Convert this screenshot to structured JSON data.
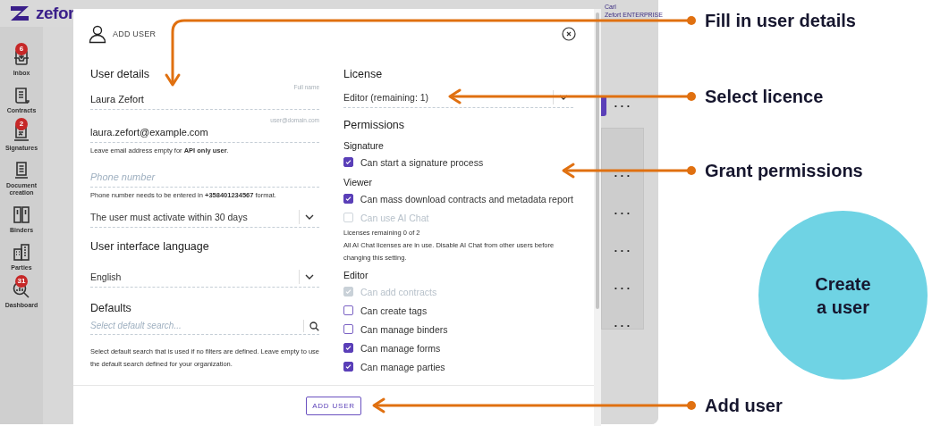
{
  "app": {
    "logo_text": "zefor",
    "user_name": "Carl",
    "user_org": "Zefort ENTERPRISE"
  },
  "sidebar": {
    "items": [
      {
        "label": "Inbox",
        "badge": "6"
      },
      {
        "label": "Contracts"
      },
      {
        "label": "Signatures",
        "badge": "2"
      },
      {
        "label": "Document creation"
      },
      {
        "label": "Binders"
      },
      {
        "label": "Parties"
      },
      {
        "label": "Dashboard",
        "badge": "31"
      }
    ]
  },
  "background_table": {
    "row_menus": [
      "• • •",
      "• • •",
      "• • •",
      "• • •",
      "• • •",
      "• • •"
    ]
  },
  "modal": {
    "title": "ADD USER",
    "user_details": {
      "heading": "User details",
      "full_name": {
        "label": "Full name",
        "value": "Laura Zefort"
      },
      "email": {
        "label": "user@domain.com",
        "value": "laura.zefort@example.com",
        "hint": "Leave email address empty for **API only user**."
      },
      "phone": {
        "placeholder": "Phone number",
        "hint": "Phone number needs to be entered in **+358401234567** format."
      },
      "activation": {
        "value": "The user must activate within 30 days"
      }
    },
    "language": {
      "heading": "User interface language",
      "value": "English"
    },
    "defaults": {
      "heading": "Defaults",
      "placeholder": "Select default search...",
      "hint": "Select default search that is used if no filters are defined. Leave empty to use the default search defined for your organization."
    },
    "license": {
      "heading": "License",
      "value": "Editor (remaining: 1)"
    },
    "permissions": {
      "heading": "Permissions",
      "groups": [
        {
          "title": "Signature",
          "items": [
            {
              "label": "Can start a signature process",
              "checked": true,
              "disabled": false
            }
          ]
        },
        {
          "title": "Viewer",
          "items": [
            {
              "label": "Can mass download contracts and metadata report",
              "checked": true,
              "disabled": false
            },
            {
              "label": "Can use AI Chat",
              "checked": false,
              "disabled": true
            }
          ],
          "notes": [
            "Licenses remaining 0 of 2",
            "All AI Chat licenses are in use. Disable AI Chat from other users before changing this setting."
          ]
        },
        {
          "title": "Editor",
          "items": [
            {
              "label": "Can add contracts",
              "checked": true,
              "disabled": true
            },
            {
              "label": "Can create tags",
              "checked": false,
              "disabled": false
            },
            {
              "label": "Can manage binders",
              "checked": false,
              "disabled": false
            },
            {
              "label": "Can manage forms",
              "checked": true,
              "disabled": false
            },
            {
              "label": "Can manage parties",
              "checked": true,
              "disabled": false
            }
          ]
        }
      ]
    },
    "submit": "ADD USER"
  },
  "annotations": [
    {
      "label": "Fill in user details"
    },
    {
      "label": "Select licence"
    },
    {
      "label": "Grant permissions"
    },
    {
      "label": "Add user"
    }
  ],
  "callout": {
    "text": "Create a user"
  }
}
